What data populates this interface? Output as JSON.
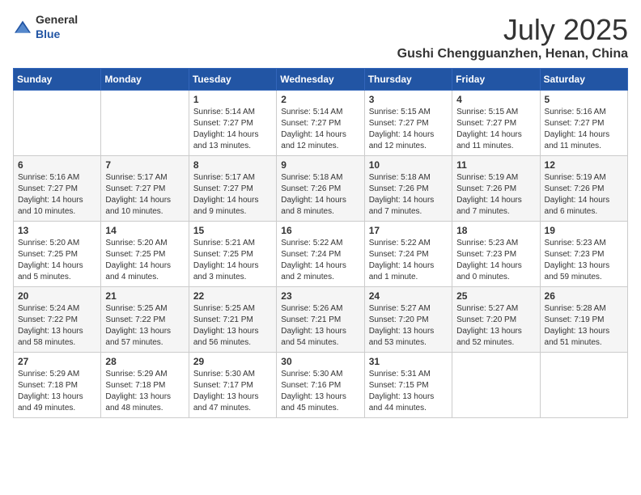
{
  "header": {
    "logo_general": "General",
    "logo_blue": "Blue",
    "month_title": "July 2025",
    "location": "Gushi Chengguanzhen, Henan, China"
  },
  "weekdays": [
    "Sunday",
    "Monday",
    "Tuesday",
    "Wednesday",
    "Thursday",
    "Friday",
    "Saturday"
  ],
  "weeks": [
    [
      {
        "day": "",
        "info": ""
      },
      {
        "day": "",
        "info": ""
      },
      {
        "day": "1",
        "info": "Sunrise: 5:14 AM\nSunset: 7:27 PM\nDaylight: 14 hours and 13 minutes."
      },
      {
        "day": "2",
        "info": "Sunrise: 5:14 AM\nSunset: 7:27 PM\nDaylight: 14 hours and 12 minutes."
      },
      {
        "day": "3",
        "info": "Sunrise: 5:15 AM\nSunset: 7:27 PM\nDaylight: 14 hours and 12 minutes."
      },
      {
        "day": "4",
        "info": "Sunrise: 5:15 AM\nSunset: 7:27 PM\nDaylight: 14 hours and 11 minutes."
      },
      {
        "day": "5",
        "info": "Sunrise: 5:16 AM\nSunset: 7:27 PM\nDaylight: 14 hours and 11 minutes."
      }
    ],
    [
      {
        "day": "6",
        "info": "Sunrise: 5:16 AM\nSunset: 7:27 PM\nDaylight: 14 hours and 10 minutes."
      },
      {
        "day": "7",
        "info": "Sunrise: 5:17 AM\nSunset: 7:27 PM\nDaylight: 14 hours and 10 minutes."
      },
      {
        "day": "8",
        "info": "Sunrise: 5:17 AM\nSunset: 7:27 PM\nDaylight: 14 hours and 9 minutes."
      },
      {
        "day": "9",
        "info": "Sunrise: 5:18 AM\nSunset: 7:26 PM\nDaylight: 14 hours and 8 minutes."
      },
      {
        "day": "10",
        "info": "Sunrise: 5:18 AM\nSunset: 7:26 PM\nDaylight: 14 hours and 7 minutes."
      },
      {
        "day": "11",
        "info": "Sunrise: 5:19 AM\nSunset: 7:26 PM\nDaylight: 14 hours and 7 minutes."
      },
      {
        "day": "12",
        "info": "Sunrise: 5:19 AM\nSunset: 7:26 PM\nDaylight: 14 hours and 6 minutes."
      }
    ],
    [
      {
        "day": "13",
        "info": "Sunrise: 5:20 AM\nSunset: 7:25 PM\nDaylight: 14 hours and 5 minutes."
      },
      {
        "day": "14",
        "info": "Sunrise: 5:20 AM\nSunset: 7:25 PM\nDaylight: 14 hours and 4 minutes."
      },
      {
        "day": "15",
        "info": "Sunrise: 5:21 AM\nSunset: 7:25 PM\nDaylight: 14 hours and 3 minutes."
      },
      {
        "day": "16",
        "info": "Sunrise: 5:22 AM\nSunset: 7:24 PM\nDaylight: 14 hours and 2 minutes."
      },
      {
        "day": "17",
        "info": "Sunrise: 5:22 AM\nSunset: 7:24 PM\nDaylight: 14 hours and 1 minute."
      },
      {
        "day": "18",
        "info": "Sunrise: 5:23 AM\nSunset: 7:23 PM\nDaylight: 14 hours and 0 minutes."
      },
      {
        "day": "19",
        "info": "Sunrise: 5:23 AM\nSunset: 7:23 PM\nDaylight: 13 hours and 59 minutes."
      }
    ],
    [
      {
        "day": "20",
        "info": "Sunrise: 5:24 AM\nSunset: 7:22 PM\nDaylight: 13 hours and 58 minutes."
      },
      {
        "day": "21",
        "info": "Sunrise: 5:25 AM\nSunset: 7:22 PM\nDaylight: 13 hours and 57 minutes."
      },
      {
        "day": "22",
        "info": "Sunrise: 5:25 AM\nSunset: 7:21 PM\nDaylight: 13 hours and 56 minutes."
      },
      {
        "day": "23",
        "info": "Sunrise: 5:26 AM\nSunset: 7:21 PM\nDaylight: 13 hours and 54 minutes."
      },
      {
        "day": "24",
        "info": "Sunrise: 5:27 AM\nSunset: 7:20 PM\nDaylight: 13 hours and 53 minutes."
      },
      {
        "day": "25",
        "info": "Sunrise: 5:27 AM\nSunset: 7:20 PM\nDaylight: 13 hours and 52 minutes."
      },
      {
        "day": "26",
        "info": "Sunrise: 5:28 AM\nSunset: 7:19 PM\nDaylight: 13 hours and 51 minutes."
      }
    ],
    [
      {
        "day": "27",
        "info": "Sunrise: 5:29 AM\nSunset: 7:18 PM\nDaylight: 13 hours and 49 minutes."
      },
      {
        "day": "28",
        "info": "Sunrise: 5:29 AM\nSunset: 7:18 PM\nDaylight: 13 hours and 48 minutes."
      },
      {
        "day": "29",
        "info": "Sunrise: 5:30 AM\nSunset: 7:17 PM\nDaylight: 13 hours and 47 minutes."
      },
      {
        "day": "30",
        "info": "Sunrise: 5:30 AM\nSunset: 7:16 PM\nDaylight: 13 hours and 45 minutes."
      },
      {
        "day": "31",
        "info": "Sunrise: 5:31 AM\nSunset: 7:15 PM\nDaylight: 13 hours and 44 minutes."
      },
      {
        "day": "",
        "info": ""
      },
      {
        "day": "",
        "info": ""
      }
    ]
  ]
}
